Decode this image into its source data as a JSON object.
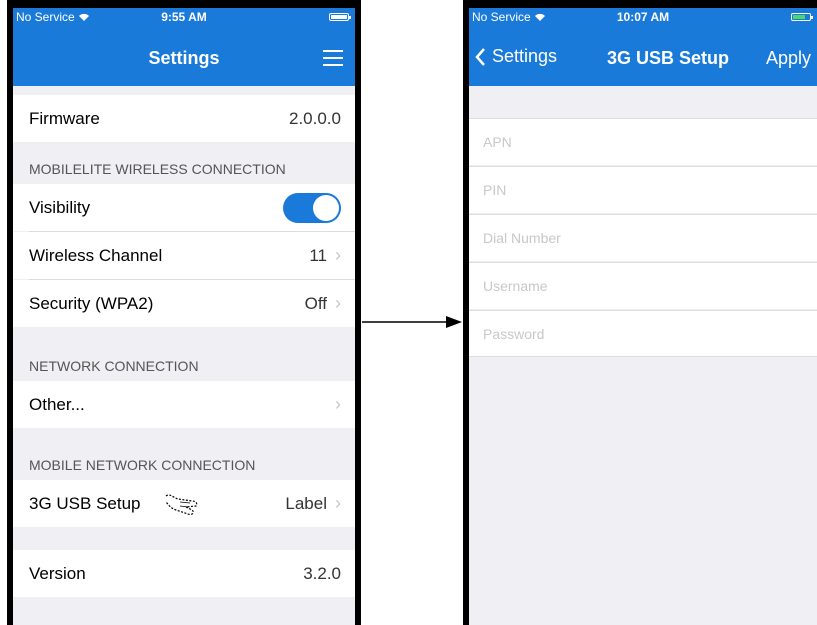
{
  "left": {
    "status": {
      "carrier": "No Service",
      "wifi_icon": "wifi-icon",
      "time": "9:55 AM"
    },
    "nav_title": "Settings",
    "firmware": {
      "label": "Firmware",
      "value": "2.0.0.0"
    },
    "section_wireless": "MOBILELITE WIRELESS CONNECTION",
    "visibility": {
      "label": "Visibility",
      "on": true
    },
    "wireless_channel": {
      "label": "Wireless Channel",
      "value": "11"
    },
    "security": {
      "label": "Security (WPA2)",
      "value": "Off"
    },
    "section_network": "NETWORK CONNECTION",
    "other": {
      "label": "Other..."
    },
    "section_mobile": "MOBILE NETWORK CONNECTION",
    "usb_setup": {
      "label": "3G USB Setup",
      "value": "Label"
    },
    "version": {
      "label": "Version",
      "value": "3.2.0"
    }
  },
  "right": {
    "status": {
      "carrier": "No Service",
      "wifi_icon": "wifi-icon",
      "time": "10:07 AM"
    },
    "back_label": "Settings",
    "nav_title": "3G USB Setup",
    "apply_label": "Apply",
    "fields": {
      "apn": "APN",
      "pin": "PIN",
      "dial": "Dial Number",
      "username": "Username",
      "password": "Password"
    }
  },
  "colors": {
    "nav_blue": "#1a7ad9",
    "group_bg": "#efeff4",
    "placeholder": "#c8c8cc"
  }
}
